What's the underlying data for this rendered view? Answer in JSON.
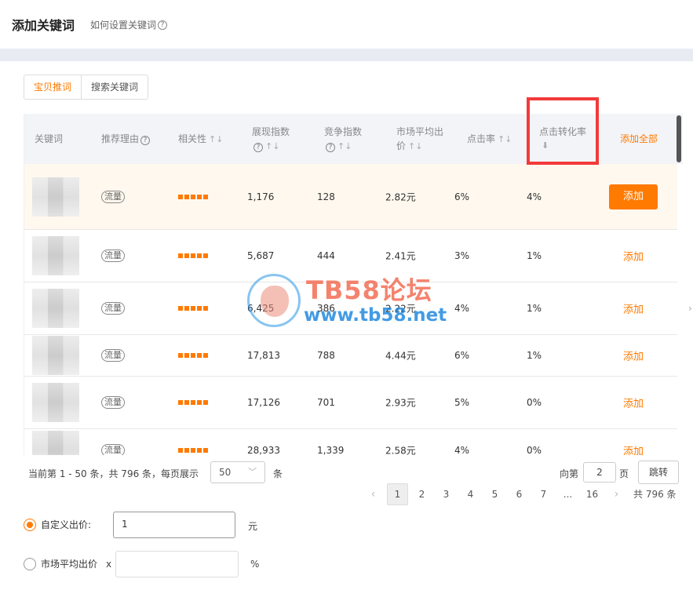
{
  "header": {
    "title": "添加关键词",
    "help": "如何设置关键词"
  },
  "tabs": [
    "宝贝推词",
    "搜索关键词"
  ],
  "columns": {
    "keyword": "关键词",
    "reason": "推荐理由",
    "relevance": "相关性",
    "impression_line1": "展现指数",
    "competition": "竞争指数",
    "avg_bid_line1": "市场平均出",
    "avg_bid_line2": "价",
    "ctr": "点击率",
    "cvr": "点击转化率",
    "add_all": "添加全部"
  },
  "rows": [
    {
      "tag": "流量",
      "relevance_stars": 5,
      "impressions": "1,176",
      "competition": "128",
      "avg_bid": "2.82元",
      "ctr": "6%",
      "cvr": "4%",
      "action": "添加"
    },
    {
      "tag": "流量",
      "relevance_stars": 5,
      "impressions": "5,687",
      "competition": "444",
      "avg_bid": "2.41元",
      "ctr": "3%",
      "cvr": "1%",
      "action": "添加"
    },
    {
      "tag": "流量",
      "relevance_stars": 5,
      "impressions": "6,425",
      "competition": "386",
      "avg_bid": "2.22元",
      "ctr": "4%",
      "cvr": "1%",
      "action": "添加"
    },
    {
      "tag": "流量",
      "relevance_stars": 5,
      "impressions": "17,813",
      "competition": "788",
      "avg_bid": "4.44元",
      "ctr": "6%",
      "cvr": "1%",
      "action": "添加"
    },
    {
      "tag": "流量",
      "relevance_stars": 5,
      "impressions": "17,126",
      "competition": "701",
      "avg_bid": "2.93元",
      "ctr": "5%",
      "cvr": "0%",
      "action": "添加"
    },
    {
      "tag": "流量",
      "relevance_stars": 5,
      "impressions": "28,933",
      "competition": "1,339",
      "avg_bid": "2.58元",
      "ctr": "4%",
      "cvr": "0%",
      "action": "添加"
    }
  ],
  "footer": {
    "info": "当前第 1 - 50 条，共 796 条，每页展示",
    "page_size": "50",
    "unit": "条",
    "goto_label": "向第",
    "goto_value": "2",
    "page_unit": "页",
    "jump": "跳转"
  },
  "pagination": {
    "pages": [
      "1",
      "2",
      "3",
      "4",
      "5",
      "6",
      "7",
      "...",
      "16"
    ],
    "current": "1",
    "total": "共 796 条"
  },
  "bid": {
    "custom_label": "自定义出价:",
    "custom_value": "1",
    "custom_unit": "元",
    "market_label": "市场平均出价",
    "market_prefix": "x",
    "market_unit": "%"
  },
  "watermark": {
    "line1": "TB58论坛",
    "line2": "www.tb58.net"
  },
  "colors": {
    "accent": "#ff7a00",
    "highlight_box": "#f23a3a"
  }
}
